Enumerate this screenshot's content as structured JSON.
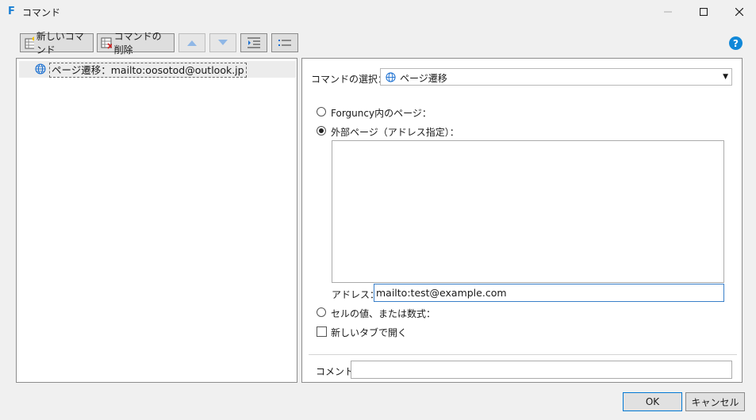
{
  "window": {
    "title": "コマンド",
    "app_icon_letter": "F"
  },
  "toolbar": {
    "new_command_label": "新しいコマンド",
    "delete_command_label": "コマンドの削除"
  },
  "tree": {
    "items": [
      {
        "label": "ページ遷移：mailto:oosotod@outlook.jp",
        "icon": "globe-icon"
      }
    ]
  },
  "command_select": {
    "label": "コマンドの選択：",
    "value": "ページ遷移",
    "icon": "globe-icon"
  },
  "options": {
    "internal_page_label": "Forguncy内のページ：",
    "external_page_label": "外部ページ（アドレス指定）：",
    "address_label": "アドレス：",
    "address_value": "mailto:test@example.com",
    "cell_value_label": "セルの値、または数式：",
    "new_tab_label": "新しいタブで開く",
    "selected": "external"
  },
  "comment": {
    "label": "コメント",
    "value": ""
  },
  "buttons": {
    "ok_label": "OK",
    "cancel_label": "キャンセル"
  },
  "colors": {
    "accent": "#0078d4",
    "help": "#1188d8"
  }
}
